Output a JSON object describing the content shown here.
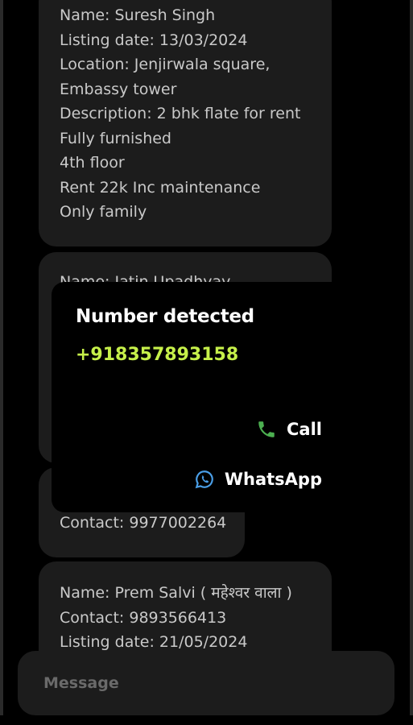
{
  "bubbles": [
    {
      "lines": [
        "Name: Suresh Singh",
        "",
        "Listing date: 13/03/2024",
        "Location: Jenjirwala square,",
        "Embassy tower",
        "Description: 2 bhk flate for rent",
        "Fully furnished",
        "4th floor",
        "Rent 22k Inc maintenance",
        "Only family"
      ]
    },
    {
      "lines": [
        "Name: Jatin Upadhyay"
      ]
    },
    {
      "lines": [
        "Contact: 9977002264"
      ]
    },
    {
      "lines": [
        "Name: Prem Salvi ( महेश्वर वाला )",
        "Contact: 9893566413",
        "Listing date: 21/05/2024"
      ]
    }
  ],
  "popup": {
    "title": "Number detected",
    "number": "+918357893158",
    "call_label": "Call",
    "whatsapp_label": "WhatsApp",
    "call_icon": "phone-icon",
    "whatsapp_icon": "whatsapp-icon",
    "number_color": "#c6f04a",
    "call_icon_color": "#4caf50",
    "whatsapp_icon_color": "#4a9fe8"
  },
  "composer": {
    "placeholder": "Message"
  }
}
